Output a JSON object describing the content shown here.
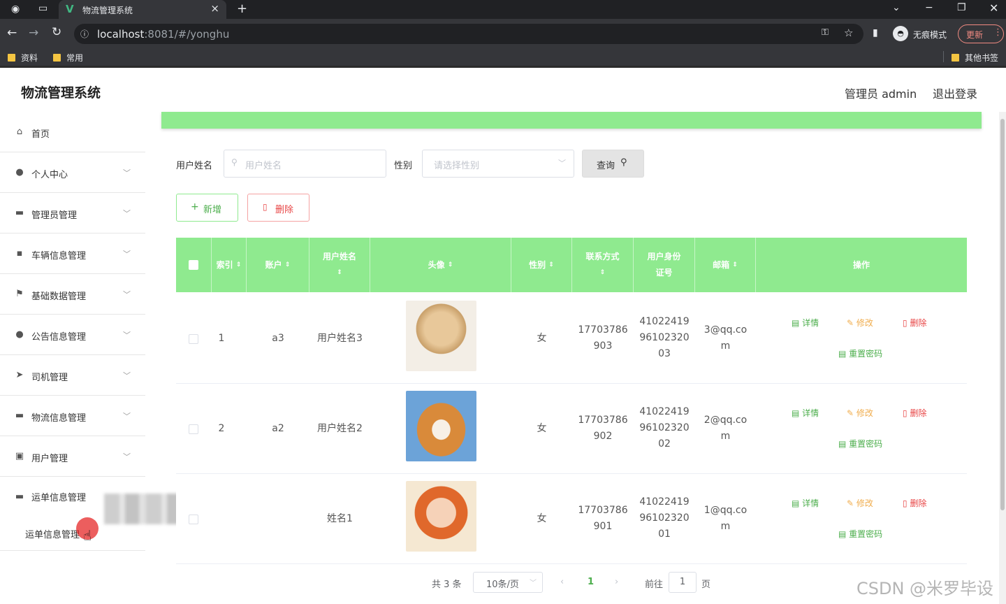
{
  "browser": {
    "tab_title": "物流管理系统",
    "url_host": "localhost",
    "url_path": ":8081/#/yonghu",
    "incognito_label": "无痕模式",
    "update_label": "更新",
    "bookmarks": [
      "资料",
      "常用"
    ],
    "other_bookmarks": "其他书签"
  },
  "header": {
    "title": "物流管理系统",
    "admin": "管理员 admin",
    "logout": "退出登录"
  },
  "sidebar": {
    "items": [
      {
        "label": "首页",
        "icon": "home-icon"
      },
      {
        "label": "个人中心",
        "icon": "user-icon"
      },
      {
        "label": "管理员管理",
        "icon": "briefcase-icon"
      },
      {
        "label": "车辆信息管理",
        "icon": "chat-icon"
      },
      {
        "label": "基础数据管理",
        "icon": "flag-icon"
      },
      {
        "label": "公告信息管理",
        "icon": "bulb-icon"
      },
      {
        "label": "司机管理",
        "icon": "send-icon"
      },
      {
        "label": "物流信息管理",
        "icon": "monitor-icon"
      },
      {
        "label": "用户管理",
        "icon": "chart-icon"
      },
      {
        "label": "运单信息管理",
        "icon": "ticket-icon"
      }
    ],
    "submenu_item": "运单信息管理"
  },
  "search": {
    "name_label": "用户姓名",
    "name_placeholder": "用户姓名",
    "gender_label": "性别",
    "gender_placeholder": "请选择性别",
    "query_button": "查询"
  },
  "toolbar": {
    "add_label": "新增",
    "delete_label": "删除"
  },
  "table": {
    "headers": [
      "索引",
      "账户",
      "用户姓名",
      "头像",
      "性别",
      "联系方式",
      "用户身份证号",
      "邮箱",
      "操作"
    ],
    "actions": {
      "detail": "详情",
      "edit": "修改",
      "delete": "删除",
      "reset": "重置密码"
    },
    "rows": [
      {
        "index": "1",
        "account": "a3",
        "name": "用户姓名3",
        "gender": "女",
        "phone": [
          "17703786",
          "903"
        ],
        "idcard": [
          "41022419",
          "96102320",
          "03"
        ],
        "email": [
          "3@qq.co",
          "m"
        ],
        "avatar": "puppy-photo"
      },
      {
        "index": "2",
        "account": "a2",
        "name": "用户姓名2",
        "gender": "女",
        "phone": [
          "17703786",
          "902"
        ],
        "idcard": [
          "41022419",
          "96102320",
          "02"
        ],
        "email": [
          "2@qq.co",
          "m"
        ],
        "avatar": "shiba-photo"
      },
      {
        "index": "",
        "account": "",
        "name": "姓名1",
        "gender": "女",
        "phone": [
          "17703786",
          "901"
        ],
        "idcard": [
          "41022419",
          "96102320",
          "01"
        ],
        "email": [
          "1@qq.co",
          "m"
        ],
        "avatar": "woman-photo"
      }
    ]
  },
  "pagination": {
    "total": "共 3 条",
    "page_size": "10条/页",
    "current_page": "1",
    "goto_label": "前往",
    "goto_value": "1",
    "page_suffix": "页"
  },
  "watermark": "CSDN @米罗毕设",
  "colors": {
    "accent": "#8fea8f",
    "green_text": "#4cae4c",
    "orange": "#f0ad4e",
    "red": "#e84545"
  }
}
